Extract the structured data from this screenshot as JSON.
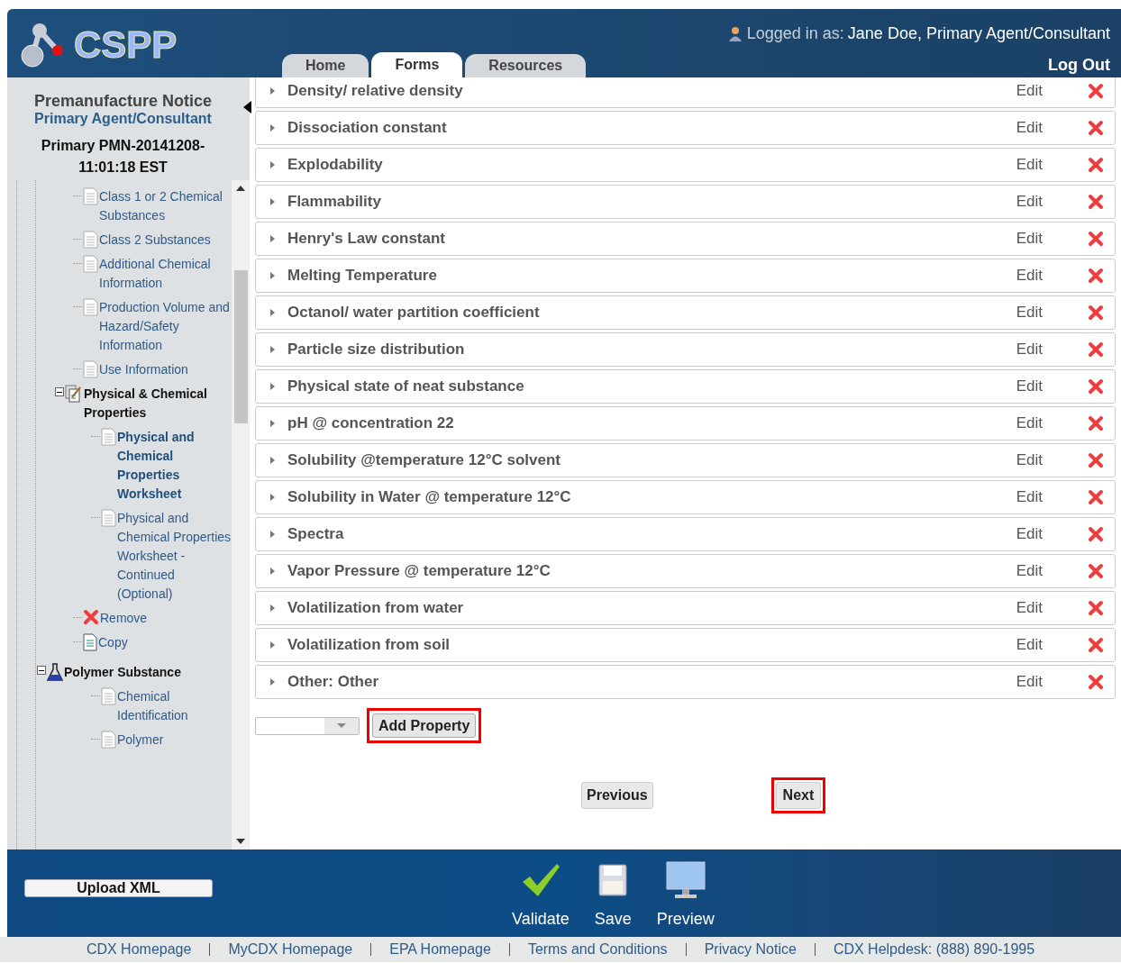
{
  "header": {
    "logo": "CSPP",
    "user_label": "Logged in as:",
    "user_name": "Jane Doe, Primary Agent/Consultant",
    "logout": "Log Out",
    "tabs": [
      {
        "label": "Home",
        "selected": false
      },
      {
        "label": "Forms",
        "selected": true
      },
      {
        "label": "Resources",
        "selected": false
      }
    ]
  },
  "sidebar": {
    "title": "Premanufacture Notice",
    "role": "Primary Agent/Consultant",
    "submission": "Primary PMN-20141208-11:01:18 EST",
    "tree": [
      {
        "label": "Class 1 or 2 Chemical Substances",
        "kind": "page",
        "selected": false
      },
      {
        "label": "Class 2 Substances",
        "kind": "page",
        "selected": false
      },
      {
        "label": "Additional Chemical Information",
        "kind": "page",
        "selected": false
      },
      {
        "label": "Production Volume and Hazard/Safety Information",
        "kind": "page",
        "selected": false
      },
      {
        "label": "Use Information",
        "kind": "page",
        "selected": false
      },
      {
        "label": "Physical & Chemical Properties",
        "kind": "section",
        "selected": false,
        "expanded": true,
        "children": [
          {
            "label": "Physical and Chemical Properties Worksheet",
            "kind": "page",
            "selected": true
          },
          {
            "label": "Physical and Chemical Properties Worksheet - Continued (Optional)",
            "kind": "page",
            "selected": false
          }
        ]
      },
      {
        "label": "Remove",
        "kind": "remove",
        "selected": false
      },
      {
        "label": "Copy",
        "kind": "copy",
        "selected": false
      },
      {
        "label": "Polymer Substance",
        "kind": "substance",
        "selected": false,
        "expanded": true,
        "children": [
          {
            "label": "Chemical Identification",
            "kind": "page",
            "selected": false
          },
          {
            "label": "Polymer",
            "kind": "page",
            "selected": false
          }
        ]
      }
    ]
  },
  "properties": [
    {
      "label": "Density/ relative density",
      "action": "Edit"
    },
    {
      "label": "Dissociation constant",
      "action": "Edit"
    },
    {
      "label": "Explodability",
      "action": "Edit"
    },
    {
      "label": "Flammability",
      "action": "Edit"
    },
    {
      "label": "Henry's Law constant",
      "action": "Edit"
    },
    {
      "label": "Melting Temperature",
      "action": "Edit"
    },
    {
      "label": "Octanol/ water partition coefficient",
      "action": "Edit"
    },
    {
      "label": "Particle size distribution",
      "action": "Edit"
    },
    {
      "label": "Physical state of neat substance",
      "action": "Edit"
    },
    {
      "label": "pH @ concentration 22",
      "action": "Edit"
    },
    {
      "label": "Solubility @temperature 12°C solvent",
      "action": "Edit"
    },
    {
      "label": "Solubility in Water @ temperature 12°C",
      "action": "Edit"
    },
    {
      "label": "Spectra",
      "action": "Edit"
    },
    {
      "label": "Vapor Pressure @ temperature 12°C",
      "action": "Edit"
    },
    {
      "label": "Volatilization from water",
      "action": "Edit"
    },
    {
      "label": "Volatilization from soil",
      "action": "Edit"
    },
    {
      "label": "Other: Other",
      "action": "Edit"
    }
  ],
  "add_button": "Add Property",
  "previous": "Previous",
  "next": "Next",
  "toolbar": {
    "upload": "Upload XML",
    "actions": [
      {
        "label": "Validate",
        "kind": "validate"
      },
      {
        "label": "Save",
        "kind": "save"
      },
      {
        "label": "Preview",
        "kind": "preview"
      }
    ]
  },
  "footer_links": [
    "CDX Homepage",
    "MyCDX Homepage",
    "EPA Homepage",
    "Terms and Conditions",
    "Privacy Notice",
    "CDX Helpdesk: (888) 890-1995"
  ]
}
